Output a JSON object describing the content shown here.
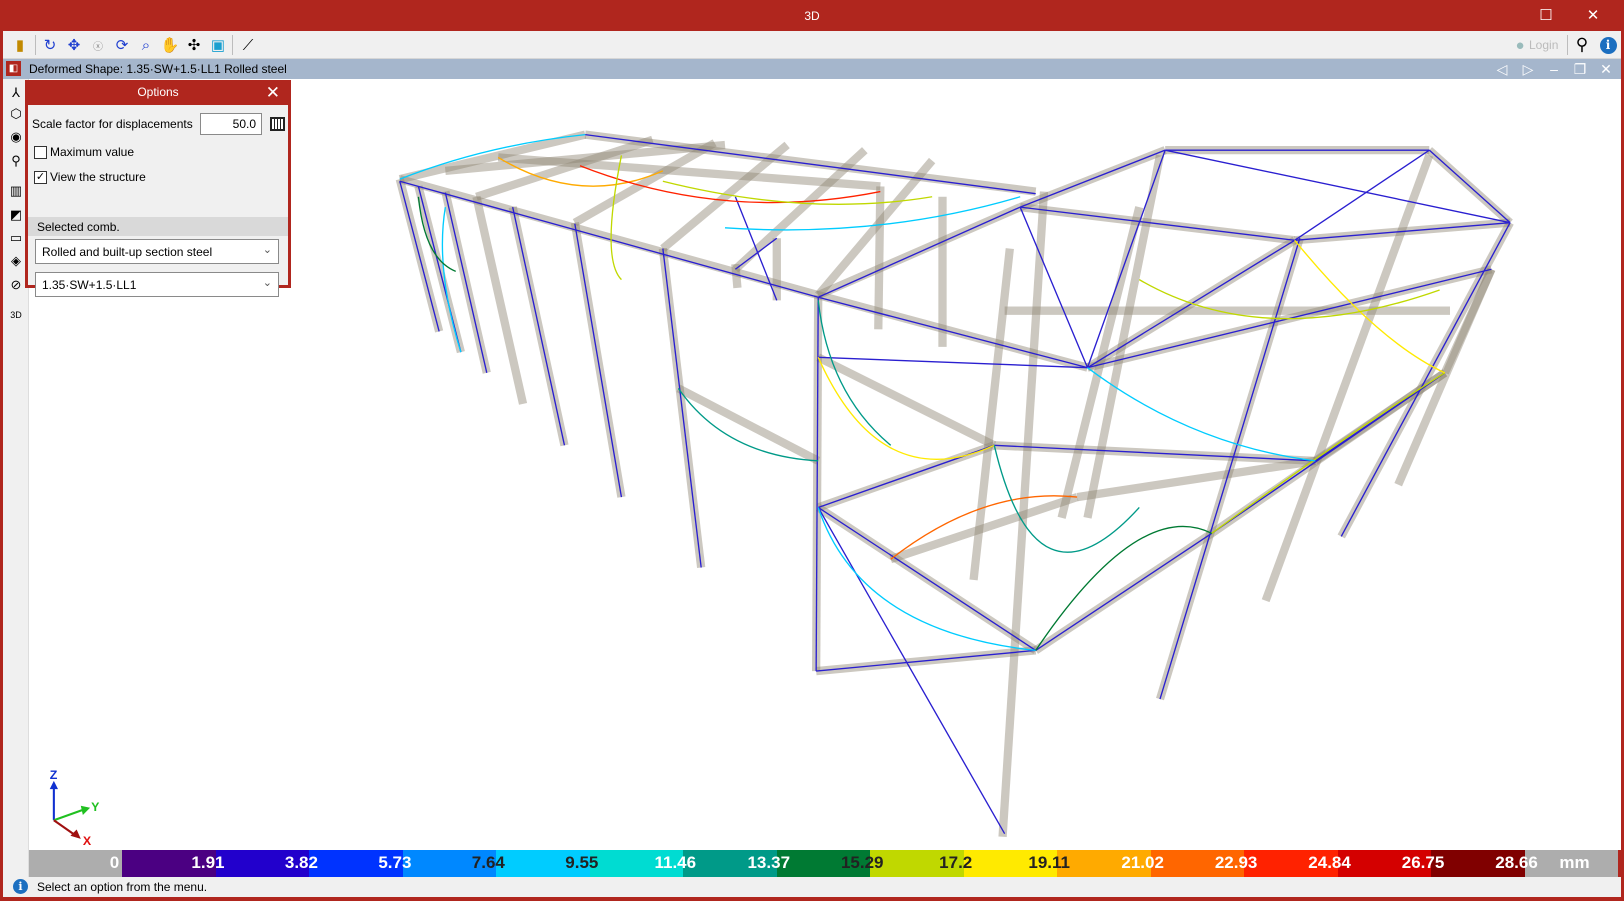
{
  "window": {
    "title": "3D",
    "maximize_icon": "maximize-icon",
    "close_icon": "close-icon"
  },
  "toolbar": {
    "icons": [
      "exit-icon",
      "rotate-icon",
      "zoom-extents-icon",
      "zoom-x2-icon",
      "redraw-icon",
      "zoom-window-icon",
      "pan-icon",
      "orbit-icon",
      "views-icon",
      "axes-icon"
    ],
    "login_label": "Login"
  },
  "document": {
    "title": "Deformed Shape: 1.35·SW+1.5·LL1 Rolled steel"
  },
  "sidebar": {
    "icons": [
      "axes-icon",
      "cube-view-icon",
      "eye-rotate-icon",
      "orbit-icon",
      "section-icon",
      "gradient-icon",
      "plane-icon",
      "layers-icon",
      "hide-icon",
      "3d-settings-icon"
    ]
  },
  "options": {
    "title": "Options",
    "scale_label": "Scale factor for displacements",
    "scale_value": "50.0",
    "max_value_label": "Maximum value",
    "max_value_checked": false,
    "view_structure_label": "View the structure",
    "view_structure_checked": true,
    "selected_comb_label": "Selected comb.",
    "material_select": "Rolled and built-up section steel",
    "comb_select": "1.35·SW+1.5·LL1"
  },
  "axes": {
    "x": "X",
    "y": "Y",
    "z": "Z"
  },
  "legend": {
    "unit": "mm",
    "labels": [
      "0",
      "1.91",
      "3.82",
      "5.73",
      "7.64",
      "9.55",
      "11.46",
      "13.37",
      "15.29",
      "17.2",
      "19.11",
      "21.02",
      "22.93",
      "24.84",
      "26.75",
      "28.66"
    ],
    "colors": [
      "#adadad",
      "#4b0082",
      "#2200cc",
      "#0033ff",
      "#0088ff",
      "#00ccff",
      "#00dcd2",
      "#009a88",
      "#007a33",
      "#c0d800",
      "#ffea00",
      "#ffaa00",
      "#ff6600",
      "#ff2200",
      "#d40000",
      "#800000",
      "#adadad"
    ]
  },
  "status": {
    "text": "Select an option from the menu."
  }
}
